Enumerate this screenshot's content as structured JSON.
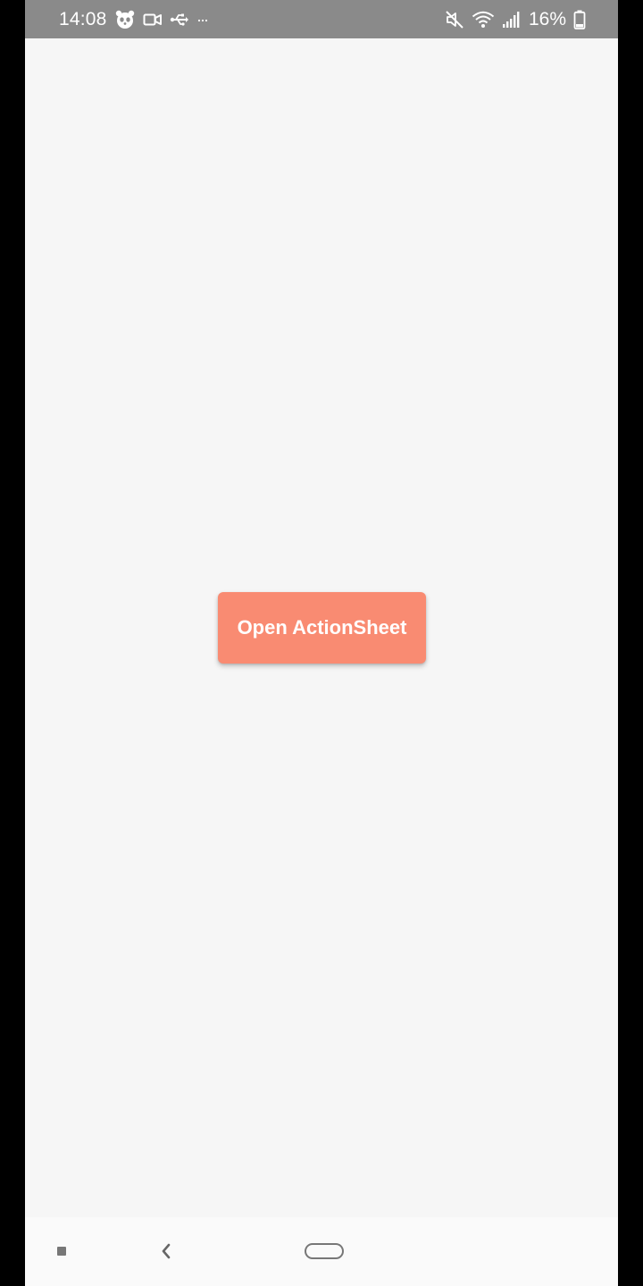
{
  "status_bar": {
    "time": "14:08",
    "battery_percent": "16%",
    "left_icons": [
      "panda-app-icon",
      "video-camera-icon",
      "usb-icon",
      "more-dots-icon"
    ],
    "right_icons": [
      "mute-icon",
      "wifi-icon",
      "signal-icon",
      "battery-icon"
    ]
  },
  "main": {
    "open_button_label": "Open ActionSheet",
    "button_color": "#f98b72",
    "background_color": "#f6f6f6"
  },
  "nav_bar": {
    "icons": [
      "recents-icon",
      "back-icon",
      "home-icon"
    ]
  }
}
